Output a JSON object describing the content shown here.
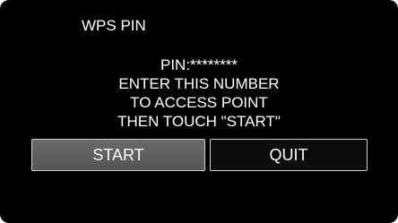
{
  "screen": {
    "title": "WPS PIN",
    "message_lines": [
      "PIN:********",
      "ENTER THIS NUMBER",
      "TO ACCESS POINT",
      "THEN TOUCH \"START\""
    ]
  },
  "buttons": {
    "start_label": "START",
    "quit_label": "QUIT"
  },
  "colors": {
    "background": "#000000",
    "text": "#ffffff",
    "start_button": "#5e5e5e",
    "quit_button": "#0c0c0c",
    "button_border": "#cfcfcf"
  }
}
